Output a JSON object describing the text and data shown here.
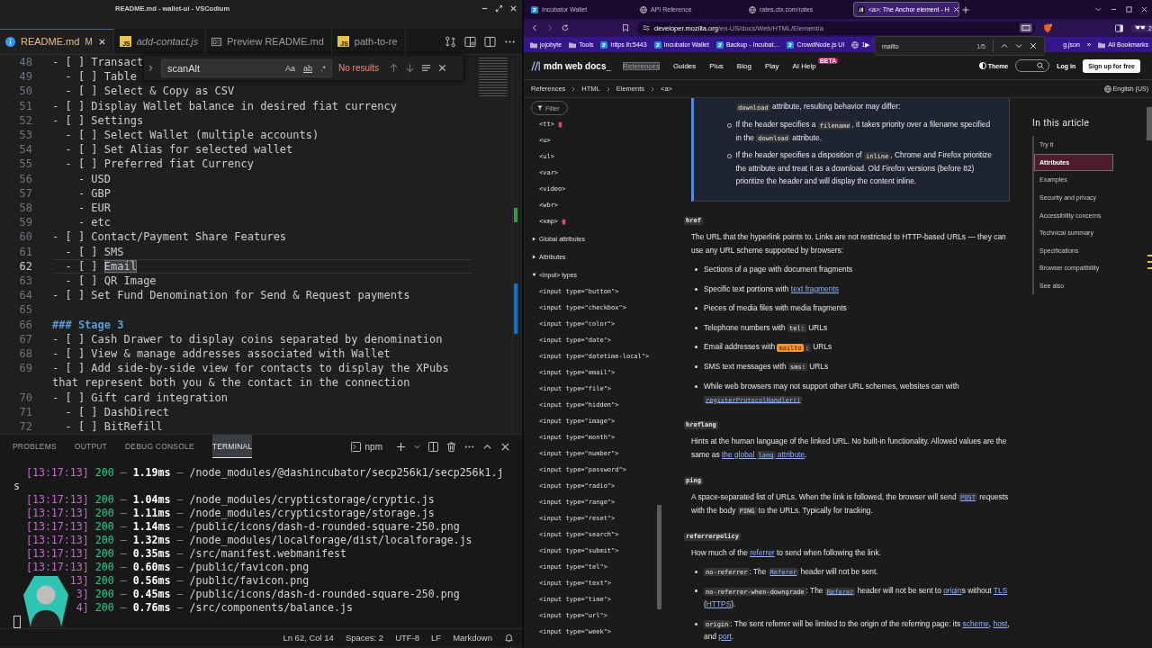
{
  "editor_window": {
    "title": "README.md - wallet-ui - VSCodium",
    "tabs": [
      {
        "label": "README.md",
        "kind": "info",
        "status": "M",
        "preview": false,
        "selected": true
      },
      {
        "label": "add-contact.js",
        "kind": "js",
        "icon_text": "JS",
        "preview": true,
        "selected": false
      },
      {
        "label": "Preview README.md",
        "kind": "markdown-preview",
        "preview": false,
        "selected": false
      },
      {
        "label": "path-to-re",
        "kind": "js",
        "icon_text": "JS",
        "preview": false,
        "selected": false
      }
    ],
    "find_widget": {
      "query": "scanAlt",
      "options": [
        {
          "label": "Aa",
          "kind": "case",
          "on": false
        },
        {
          "label": "ab",
          "kind": "word",
          "on": false
        },
        {
          "label": ".*",
          "kind": "regex",
          "on": false
        }
      ],
      "result": "No results"
    },
    "lines": [
      {
        "number": "48",
        "kind": "text",
        "current": false,
        "text": "- [ ] Transact"
      },
      {
        "number": "49",
        "kind": "text",
        "current": false,
        "text": "  - [ ] Table"
      },
      {
        "number": "50",
        "kind": "text",
        "current": false,
        "text": "  - [ ] Select & Copy as CSV"
      },
      {
        "number": "51",
        "kind": "text",
        "current": false,
        "text": "- [ ] Display Wallet balance in desired fiat currency"
      },
      {
        "number": "52",
        "kind": "text",
        "current": false,
        "text": "- [ ] Settings"
      },
      {
        "number": "53",
        "kind": "text",
        "current": false,
        "text": "  - [ ] Select Wallet (multiple accounts)"
      },
      {
        "number": "54",
        "kind": "text",
        "current": false,
        "text": "  - [ ] Set Alias for selected wallet"
      },
      {
        "number": "55",
        "kind": "text",
        "current": false,
        "text": "  - [ ] Preferred fiat Currency"
      },
      {
        "number": "56",
        "kind": "text",
        "current": false,
        "text": "    - USD"
      },
      {
        "number": "57",
        "kind": "text",
        "current": false,
        "text": "    - GBP"
      },
      {
        "number": "58",
        "kind": "text",
        "current": false,
        "text": "    - EUR"
      },
      {
        "number": "59",
        "kind": "text",
        "current": false,
        "text": "    - etc"
      },
      {
        "number": "60",
        "kind": "text",
        "current": false,
        "text": "- [ ] Contact/Payment Share Features"
      },
      {
        "number": "61",
        "kind": "text",
        "current": false,
        "text": "  - [ ] SMS"
      },
      {
        "number": "62",
        "kind": "text",
        "current": true,
        "text": "  - [ ] ",
        "selection": "Email"
      },
      {
        "number": "63",
        "kind": "text",
        "current": false,
        "text": "  - [ ] QR Image"
      },
      {
        "number": "64",
        "kind": "text",
        "current": false,
        "text": "- [ ] Set Fund Denomination for Send & Request payments"
      },
      {
        "number": "65",
        "kind": "blank",
        "current": false
      },
      {
        "number": "66",
        "kind": "heading",
        "current": false,
        "text": "### Stage 3"
      },
      {
        "number": "67",
        "kind": "text",
        "current": false,
        "text": "- [ ] Cash Drawer to display coins separated by denomination"
      },
      {
        "number": "68",
        "kind": "text",
        "current": false,
        "text": "- [ ] View & manage addresses associated with Wallet"
      },
      {
        "number": "69",
        "kind": "text",
        "current": false,
        "text": "- [ ] Add side-by-side view for contacts to display the XPubs that represent both you & the contact in the connection"
      },
      {
        "number": "70",
        "kind": "text",
        "current": false,
        "text": "- [ ] Gift card integration"
      },
      {
        "number": "71",
        "kind": "text",
        "current": false,
        "text": "  - [ ] DashDirect"
      },
      {
        "number": "72",
        "kind": "text",
        "current": false,
        "text": "  - [ ] BitRefill"
      }
    ],
    "panel": {
      "tabs": [
        {
          "label": "PROBLEMS",
          "selected": false
        },
        {
          "label": "OUTPUT",
          "selected": false
        },
        {
          "label": "DEBUG CONSOLE",
          "selected": false
        },
        {
          "label": "TERMINAL",
          "selected": true
        }
      ],
      "terminal_label": "npm",
      "terminal_lines": [
        "[13:17:13] 200 — 1.19ms — /node_modules/@dashincubator/secp256k1/secp256k1.js",
        "[13:17:13] 200 — 1.04ms — /node_modules/crypticstorage/cryptic.js",
        "[13:17:13] 200 — 1.11ms — /node_modules/crypticstorage/storage.js",
        "[13:17:13] 200 — 1.14ms — /public/icons/dash-d-rounded-square-250.png",
        "[13:17:13] 200 — 1.32ms — /node_modules/localforage/dist/localforage.js",
        "[13:17:13] 200 — 0.35ms — /src/manifest.webmanifest",
        "[13:17:13] 200 — 0.60ms — /public/favicon.png",
        "13] 200 — 0.56ms — /public/favicon.png",
        "3] 200 — 0.45ms — /public/icons/dash-d-rounded-square-250.png",
        "4] 200 — 0.76ms — /src/components/balance.js"
      ]
    },
    "status_bar": [
      "Ln 62, Col 14",
      "Spaces: 2",
      "UTF-8",
      "LF",
      "Markdown"
    ]
  },
  "browser": {
    "tabs": [
      {
        "title": "Incubator Wallet",
        "kind": "app",
        "selected": false
      },
      {
        "title": "API Reference",
        "kind": "globe",
        "selected": false
      },
      {
        "title": "rates.ctx.com/rates",
        "kind": "globe",
        "selected": false
      },
      {
        "title": "<a>: The Anchor element - H",
        "kind": "logo",
        "selected": true
      }
    ],
    "address": {
      "host": "developer.mozilla.org",
      "path": "/en-US/docs/Web/HTML/Element/a"
    },
    "glasses_count": "2",
    "bookmarks": [
      {
        "label": "jojobyte",
        "kind": "folder"
      },
      {
        "label": "Tools",
        "kind": "folder"
      },
      {
        "label": "https lh:5443",
        "kind": "app"
      },
      {
        "label": "Incubator Wallet",
        "kind": "app"
      },
      {
        "label": "Backup - Incubat…",
        "kind": "app"
      },
      {
        "label": "CrowdNode.js UI",
        "kind": "app"
      },
      {
        "label": "1▶",
        "kind": "globe"
      }
    ],
    "bookmarks_right": [
      {
        "label": "g.json"
      }
    ],
    "bookmarks_overflow": "»",
    "all_bookmarks": "All Bookmarks",
    "find_bar": {
      "query": "mailto",
      "count": "1/5"
    }
  },
  "page": {
    "logo": "mdn web docs_",
    "nav": [
      {
        "label": "References",
        "selected": true
      },
      {
        "label": "Guides",
        "selected": false
      },
      {
        "label": "Plus",
        "selected": false
      },
      {
        "label": "Blog",
        "selected": false
      },
      {
        "label": "Play",
        "selected": false
      },
      {
        "label": "AI Help",
        "selected": false,
        "badge": "BETA"
      }
    ],
    "theme_label": "Theme",
    "login_label": "Log in",
    "signup_label": "Sign up for free",
    "breadcrumbs": [
      "References",
      "HTML",
      "Elements",
      "<a>"
    ],
    "language": "English (US)",
    "sidebar": {
      "filter_label": "Filter",
      "elements": [
        {
          "label": "<tt>",
          "deprecated": true
        },
        {
          "label": "<u>",
          "deprecated": false
        },
        {
          "label": "<ul>",
          "deprecated": false
        },
        {
          "label": "<var>",
          "deprecated": false
        },
        {
          "label": "<video>",
          "deprecated": false
        },
        {
          "label": "<wbr>",
          "deprecated": false
        },
        {
          "label": "<xmp>",
          "deprecated": true
        }
      ],
      "sections": [
        {
          "label": "Global attributes",
          "expanded": false
        },
        {
          "label": "Attributes",
          "expanded": false
        },
        {
          "label": "<input> types",
          "expanded": true,
          "children": [
            {
              "label": "<input type=\"button\">"
            },
            {
              "label": "<input type=\"checkbox\">"
            },
            {
              "label": "<input type=\"color\">"
            },
            {
              "label": "<input type=\"date\">"
            },
            {
              "label": "<input type=\"datetime-local\">"
            },
            {
              "label": "<input type=\"email\">"
            },
            {
              "label": "<input type=\"file\">"
            },
            {
              "label": "<input type=\"hidden\">"
            },
            {
              "label": "<input type=\"image\">"
            },
            {
              "label": "<input type=\"month\">"
            },
            {
              "label": "<input type=\"number\">"
            },
            {
              "label": "<input type=\"password\">"
            },
            {
              "label": "<input type=\"radio\">"
            },
            {
              "label": "<input type=\"range\">"
            },
            {
              "label": "<input type=\"reset\">"
            },
            {
              "label": "<input type=\"search\">"
            },
            {
              "label": "<input type=\"submit\">"
            },
            {
              "label": "<input type=\"tel\">"
            },
            {
              "label": "<input type=\"text\">"
            },
            {
              "label": "<input type=\"time\">"
            },
            {
              "label": "<input type=\"url\">"
            },
            {
              "label": "<input type=\"week\">"
            }
          ]
        }
      ]
    },
    "content": [
      {
        "kind": "note",
        "paragraph": [
          {
            "kind": "code",
            "text": "download"
          },
          {
            "kind": "text",
            "text": " attribute, resulting behavior may differ:"
          }
        ],
        "items": [
          [
            {
              "kind": "text",
              "text": "If the header specifies a "
            },
            {
              "kind": "code",
              "text": "filename"
            },
            {
              "kind": "text",
              "text": ", it takes priority over a filename specified in the "
            },
            {
              "kind": "code",
              "text": "download"
            },
            {
              "kind": "text",
              "text": " attribute."
            }
          ],
          [
            {
              "kind": "text",
              "text": "If the header specifies a disposition of "
            },
            {
              "kind": "code",
              "text": "inline"
            },
            {
              "kind": "text",
              "text": ", Chrome and Firefox prioritize the attribute and treat it as a download. Old Firefox versions (before 82) prioritize the header and will display the content inline."
            }
          ]
        ]
      },
      {
        "kind": "term",
        "text": "href"
      },
      {
        "kind": "paragraph",
        "segments": [
          {
            "kind": "text",
            "text": "The URL that the hyperlink points to. Links are not restricted to HTTP-based URLs — they can use any URL scheme supported by browsers:"
          }
        ]
      },
      {
        "kind": "list",
        "items": [
          [
            {
              "kind": "text",
              "text": "Sections of a page with document fragments"
            }
          ],
          [
            {
              "kind": "text",
              "text": "Specific text portions with "
            },
            {
              "kind": "link",
              "parts": [
                {
                  "kind": "text",
                  "text": "text fragments"
                }
              ]
            }
          ],
          [
            {
              "kind": "text",
              "text": "Pieces of media files with media fragments"
            }
          ],
          [
            {
              "kind": "text",
              "text": "Telephone numbers with "
            },
            {
              "kind": "code",
              "text": "tel:"
            },
            {
              "kind": "text",
              "text": " URLs"
            }
          ],
          [
            {
              "kind": "text",
              "text": "Email addresses with "
            },
            {
              "kind": "match",
              "text": "mailto"
            },
            {
              "kind": "code",
              "text": ":"
            },
            {
              "kind": "text",
              "text": " URLs"
            }
          ],
          [
            {
              "kind": "text",
              "text": "SMS text messages with "
            },
            {
              "kind": "code",
              "text": "sms:"
            },
            {
              "kind": "text",
              "text": " URLs"
            }
          ],
          [
            {
              "kind": "text",
              "text": "While web browsers may not support other URL schemes, websites can with "
            },
            {
              "kind": "link",
              "parts": [
                {
                  "kind": "code",
                  "text": "registerProtocolHandler()"
                }
              ]
            }
          ]
        ]
      },
      {
        "kind": "term",
        "text": "hreflang"
      },
      {
        "kind": "paragraph",
        "segments": [
          {
            "kind": "text",
            "text": "Hints at the human language of the linked URL. No built-in functionality. Allowed values are the same as "
          },
          {
            "kind": "link",
            "parts": [
              {
                "kind": "text",
                "text": "the global "
              },
              {
                "kind": "code",
                "text": "lang"
              },
              {
                "kind": "text",
                "text": " attribute"
              }
            ]
          },
          {
            "kind": "text",
            "text": "."
          }
        ]
      },
      {
        "kind": "term",
        "text": "ping"
      },
      {
        "kind": "paragraph",
        "segments": [
          {
            "kind": "text",
            "text": "A space-separated list of URLs. When the link is followed, the browser will send "
          },
          {
            "kind": "link",
            "parts": [
              {
                "kind": "code",
                "text": "POST"
              }
            ]
          },
          {
            "kind": "text",
            "text": " requests with the body "
          },
          {
            "kind": "code",
            "text": "PING"
          },
          {
            "kind": "text",
            "text": " to the URLs. Typically for tracking."
          }
        ]
      },
      {
        "kind": "term",
        "text": "referrerpolicy"
      },
      {
        "kind": "paragraph",
        "segments": [
          {
            "kind": "text",
            "text": "How much of the "
          },
          {
            "kind": "link",
            "parts": [
              {
                "kind": "text",
                "text": "referrer"
              }
            ]
          },
          {
            "kind": "text",
            "text": " to send when following the link."
          }
        ]
      },
      {
        "kind": "list",
        "items": [
          [
            {
              "kind": "code",
              "text": "no-referrer"
            },
            {
              "kind": "text",
              "text": ": The "
            },
            {
              "kind": "link",
              "parts": [
                {
                  "kind": "code",
                  "text": "Referer"
                }
              ]
            },
            {
              "kind": "text",
              "text": " header will not be sent."
            }
          ],
          [
            {
              "kind": "code",
              "text": "no-referrer-when-downgrade"
            },
            {
              "kind": "text",
              "text": ": The "
            },
            {
              "kind": "link",
              "parts": [
                {
                  "kind": "code",
                  "text": "Referer"
                }
              ]
            },
            {
              "kind": "text",
              "text": " header will not be sent to "
            },
            {
              "kind": "link",
              "parts": [
                {
                  "kind": "text",
                  "text": "origin"
                }
              ]
            },
            {
              "kind": "text",
              "text": "s without "
            },
            {
              "kind": "link",
              "parts": [
                {
                  "kind": "text",
                  "text": "TLS"
                }
              ]
            },
            {
              "kind": "text",
              "text": " ("
            },
            {
              "kind": "link",
              "parts": [
                {
                  "kind": "text",
                  "text": "HTTPS"
                }
              ]
            },
            {
              "kind": "text",
              "text": ")."
            }
          ],
          [
            {
              "kind": "code",
              "text": "origin"
            },
            {
              "kind": "text",
              "text": ": The sent referrer will be limited to the origin of the referring page: its "
            },
            {
              "kind": "link",
              "parts": [
                {
                  "kind": "text",
                  "text": "scheme"
                }
              ]
            },
            {
              "kind": "text",
              "text": ", "
            },
            {
              "kind": "link",
              "parts": [
                {
                  "kind": "text",
                  "text": "host"
                }
              ]
            },
            {
              "kind": "text",
              "text": ", and "
            },
            {
              "kind": "link",
              "parts": [
                {
                  "kind": "text",
                  "text": "port"
                }
              ]
            },
            {
              "kind": "text",
              "text": "."
            }
          ]
        ]
      }
    ],
    "toc": {
      "title": "In this article",
      "items": [
        {
          "label": "Try it",
          "selected": false
        },
        {
          "label": "Attributes",
          "selected": true
        },
        {
          "label": "Examples",
          "selected": false
        },
        {
          "label": "Security and privacy",
          "selected": false
        },
        {
          "label": "Accessibility concerns",
          "selected": false
        },
        {
          "label": "Technical summary",
          "selected": false
        },
        {
          "label": "Specifications",
          "selected": false
        },
        {
          "label": "Browser compatibility",
          "selected": false
        },
        {
          "label": "See also",
          "selected": false
        }
      ]
    }
  }
}
